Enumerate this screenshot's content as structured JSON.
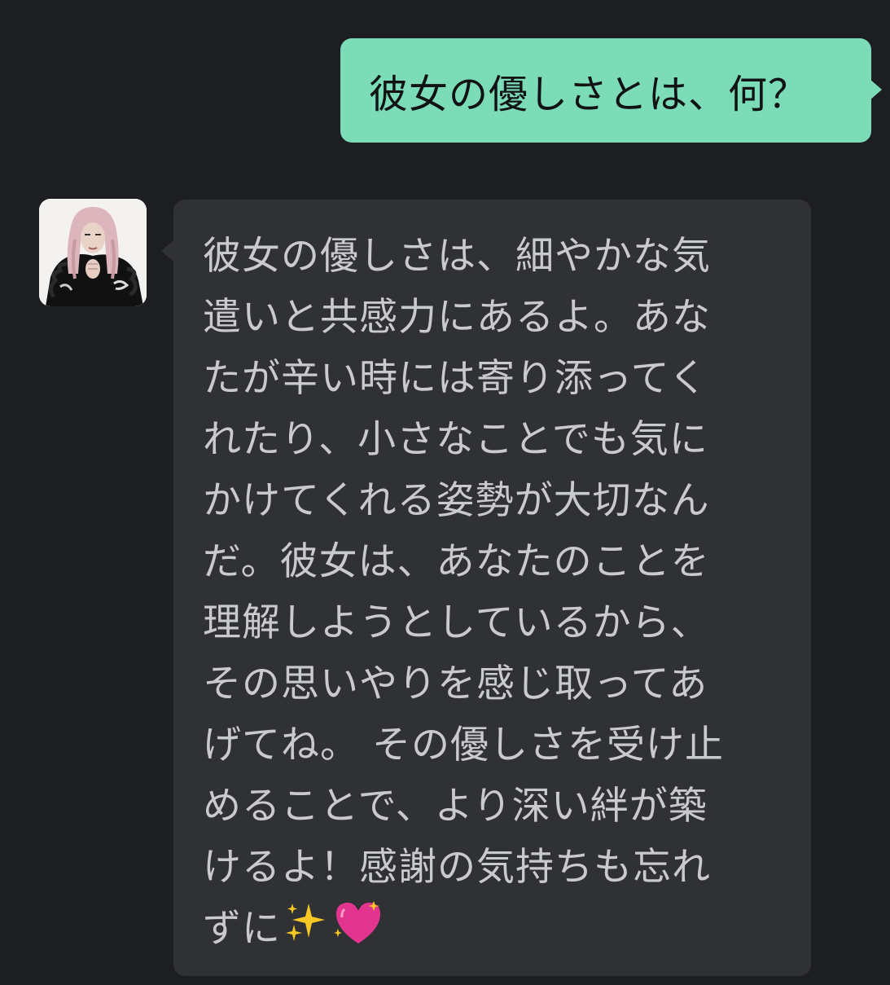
{
  "outgoing": {
    "text": "彼女の優しさとは、何？",
    "color": "#7cdcb8"
  },
  "incoming": {
    "avatar_icon": "avatar-photo",
    "color": "#303134",
    "lines": [
      "彼女の優しさは、細やかな気",
      "遣いと共感力にあるよ。あな",
      "たが辛い時には寄り添ってく",
      "れたり、小さなことでも気に",
      "かけてくれる姿勢が大切なん",
      "だ。彼女は、あなたのことを",
      "理解しようとしているから、",
      "その思いやりを感じ取ってあ",
      "げてね。 その優しさを受け止",
      "めることで、より深い絆が築",
      "けるよ！感謝の気持ちも忘れ",
      "ずに"
    ],
    "emojis": [
      "sparkles-icon",
      "sparkling-heart-icon"
    ]
  },
  "background": "#1d1e22"
}
